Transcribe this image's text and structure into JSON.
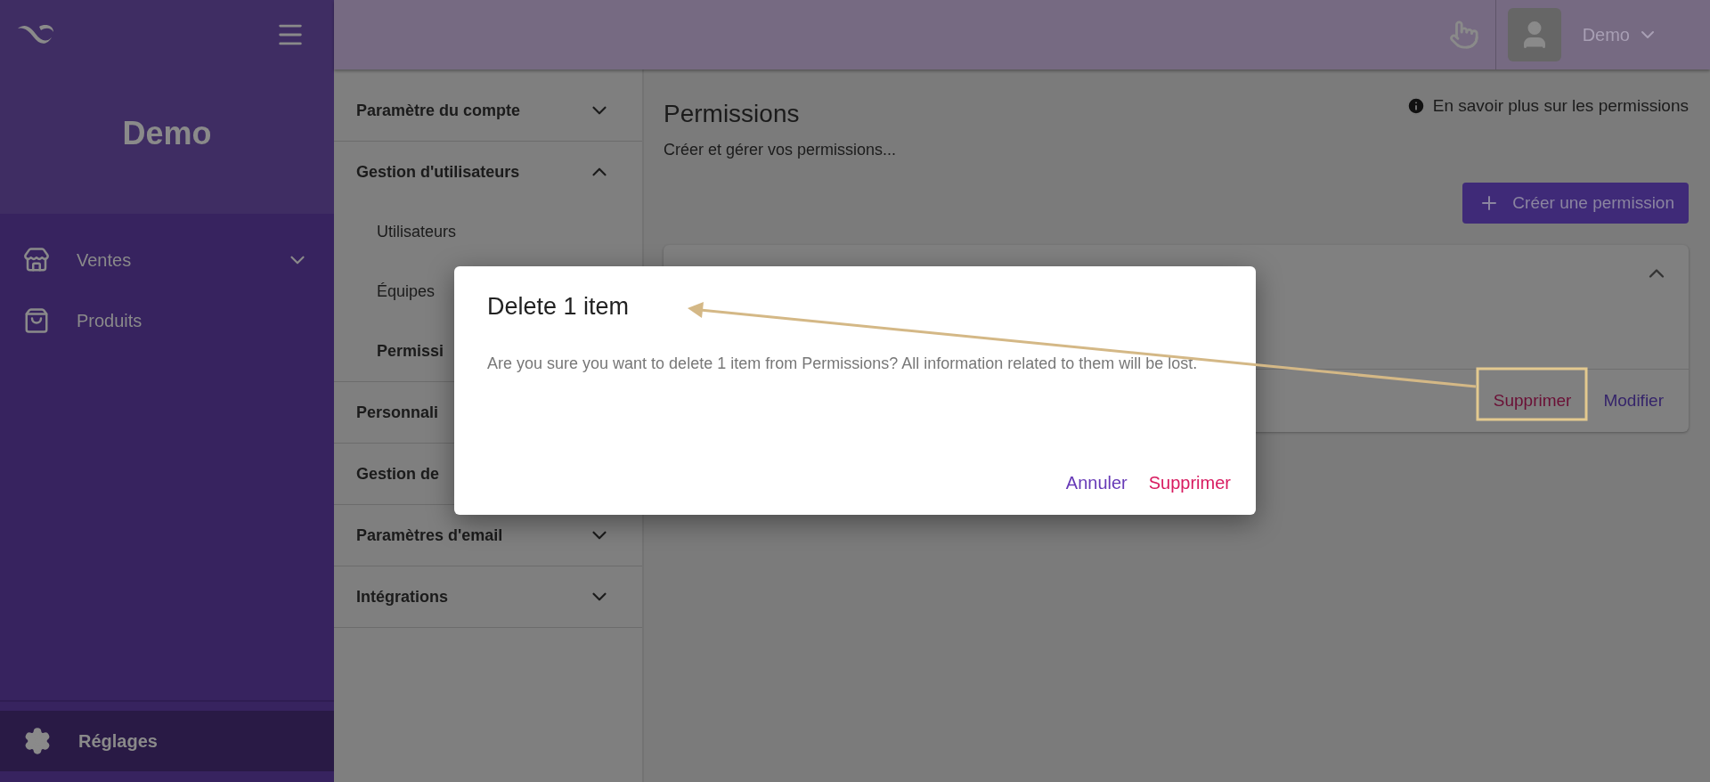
{
  "sidebar": {
    "brand": "Demo",
    "nav": [
      {
        "label": "Ventes",
        "kind": "group",
        "expanded": false
      },
      {
        "label": "Produits",
        "kind": "link"
      }
    ],
    "footer": {
      "label": "Réglages",
      "selected": true
    }
  },
  "header": {
    "user": "Demo"
  },
  "settings_menu": [
    {
      "label": "Paramètre du compte",
      "expanded": false
    },
    {
      "label": "Gestion d'utilisateurs",
      "expanded": true,
      "children": [
        {
          "label": "Utilisateurs",
          "selected": false
        },
        {
          "label": "Équipes",
          "selected": false
        },
        {
          "label": "Permissi",
          "selected": true
        }
      ]
    },
    {
      "label": "Personnali"
    },
    {
      "label": "Gestion de"
    },
    {
      "label": "Paramètres d'email",
      "expanded": false
    },
    {
      "label": "Intégrations",
      "expanded": false
    }
  ],
  "main": {
    "title": "Permissions",
    "subtitle": "Créer et gérer vos permissions...",
    "info_link": "En savoir plus sur les permissions",
    "create_button": "Créer une permission",
    "card": {
      "expanded": true,
      "actions": [
        {
          "label": "Supprimer",
          "kind": "danger"
        },
        {
          "label": "Modifier",
          "kind": "primary"
        }
      ]
    }
  },
  "dialog": {
    "title": "Delete 1 item",
    "message": "Are you sure you want to delete 1 item from Permissions? All information related to them will be lost.",
    "buttons": [
      {
        "label": "Annuler",
        "kind": "primary"
      },
      {
        "label": "Supprimer",
        "kind": "danger"
      }
    ]
  }
}
